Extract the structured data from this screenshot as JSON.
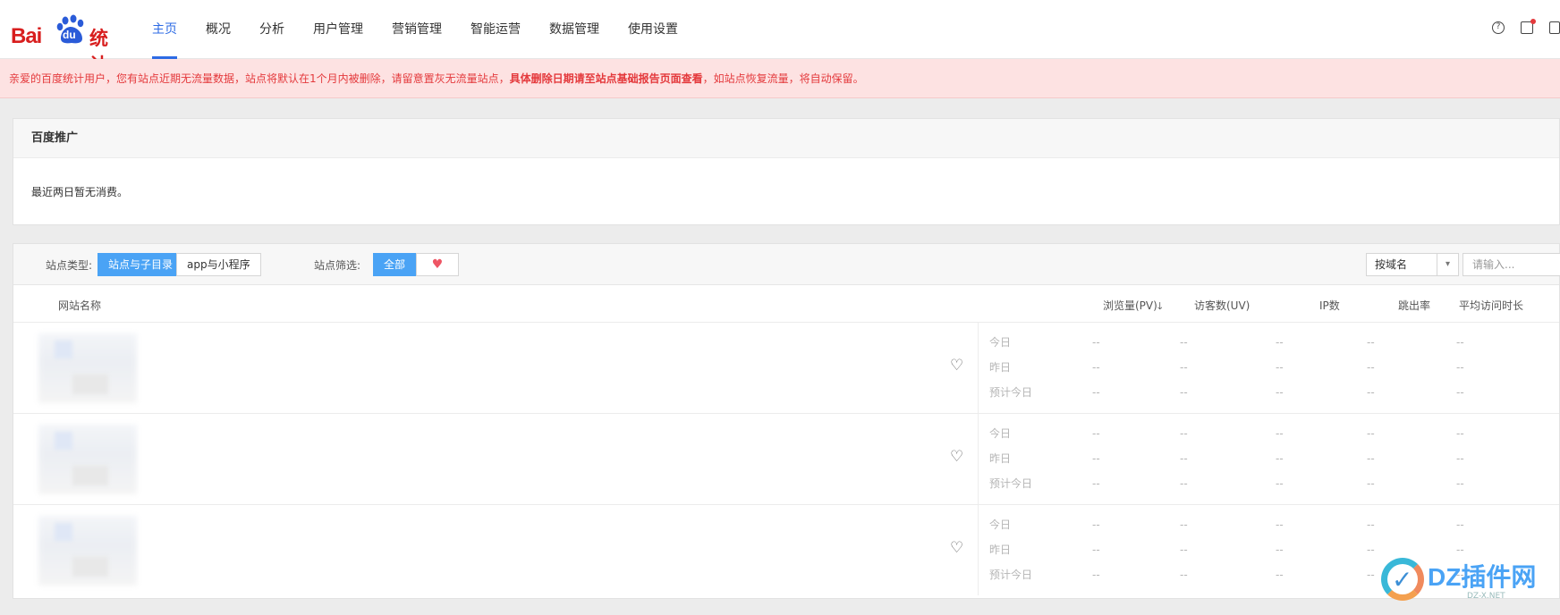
{
  "logo": {
    "bai": "Bai",
    "du": "du",
    "tongji": "统计"
  },
  "nav": [
    {
      "label": "主页",
      "active": true
    },
    {
      "label": "概况"
    },
    {
      "label": "分析"
    },
    {
      "label": "用户管理"
    },
    {
      "label": "营销管理"
    },
    {
      "label": "智能运营"
    },
    {
      "label": "数据管理"
    },
    {
      "label": "使用设置"
    }
  ],
  "top_icons": {
    "help": "?",
    "mail": "",
    "chart": ""
  },
  "alert": {
    "text_before": "亲爱的百度统计用户，您有站点近期无流量数据，站点将默认在1个月内被删除，请留意置灰无流量站点，",
    "bold": "具体删除日期请至站点基础报告页面查看",
    "text_after": "，如站点恢复流量，将自动保留。"
  },
  "promo": {
    "title": "百度推广",
    "body": "最近两日暂无消费。"
  },
  "filters": {
    "site_type_label": "站点类型:",
    "site_type_options": [
      "站点与子目录",
      "app与小程序"
    ],
    "site_filter_label": "站点筛选:",
    "site_filter_all": "全部",
    "heart": "♥",
    "domain_select": "按域名",
    "search_placeholder": "请输入..."
  },
  "table": {
    "site_name_header": "网站名称",
    "columns": [
      "浏览量(PV)",
      "访客数(UV)",
      "IP数",
      "跳出率",
      "平均访问时长"
    ],
    "sort_arrow": "🡓",
    "row_labels": [
      "今日",
      "昨日",
      "预计今日"
    ],
    "empty_value": "--",
    "fav_icon": "♡"
  },
  "watermark": {
    "text": "DZ插件网",
    "sub": "DZ-X.NET"
  }
}
